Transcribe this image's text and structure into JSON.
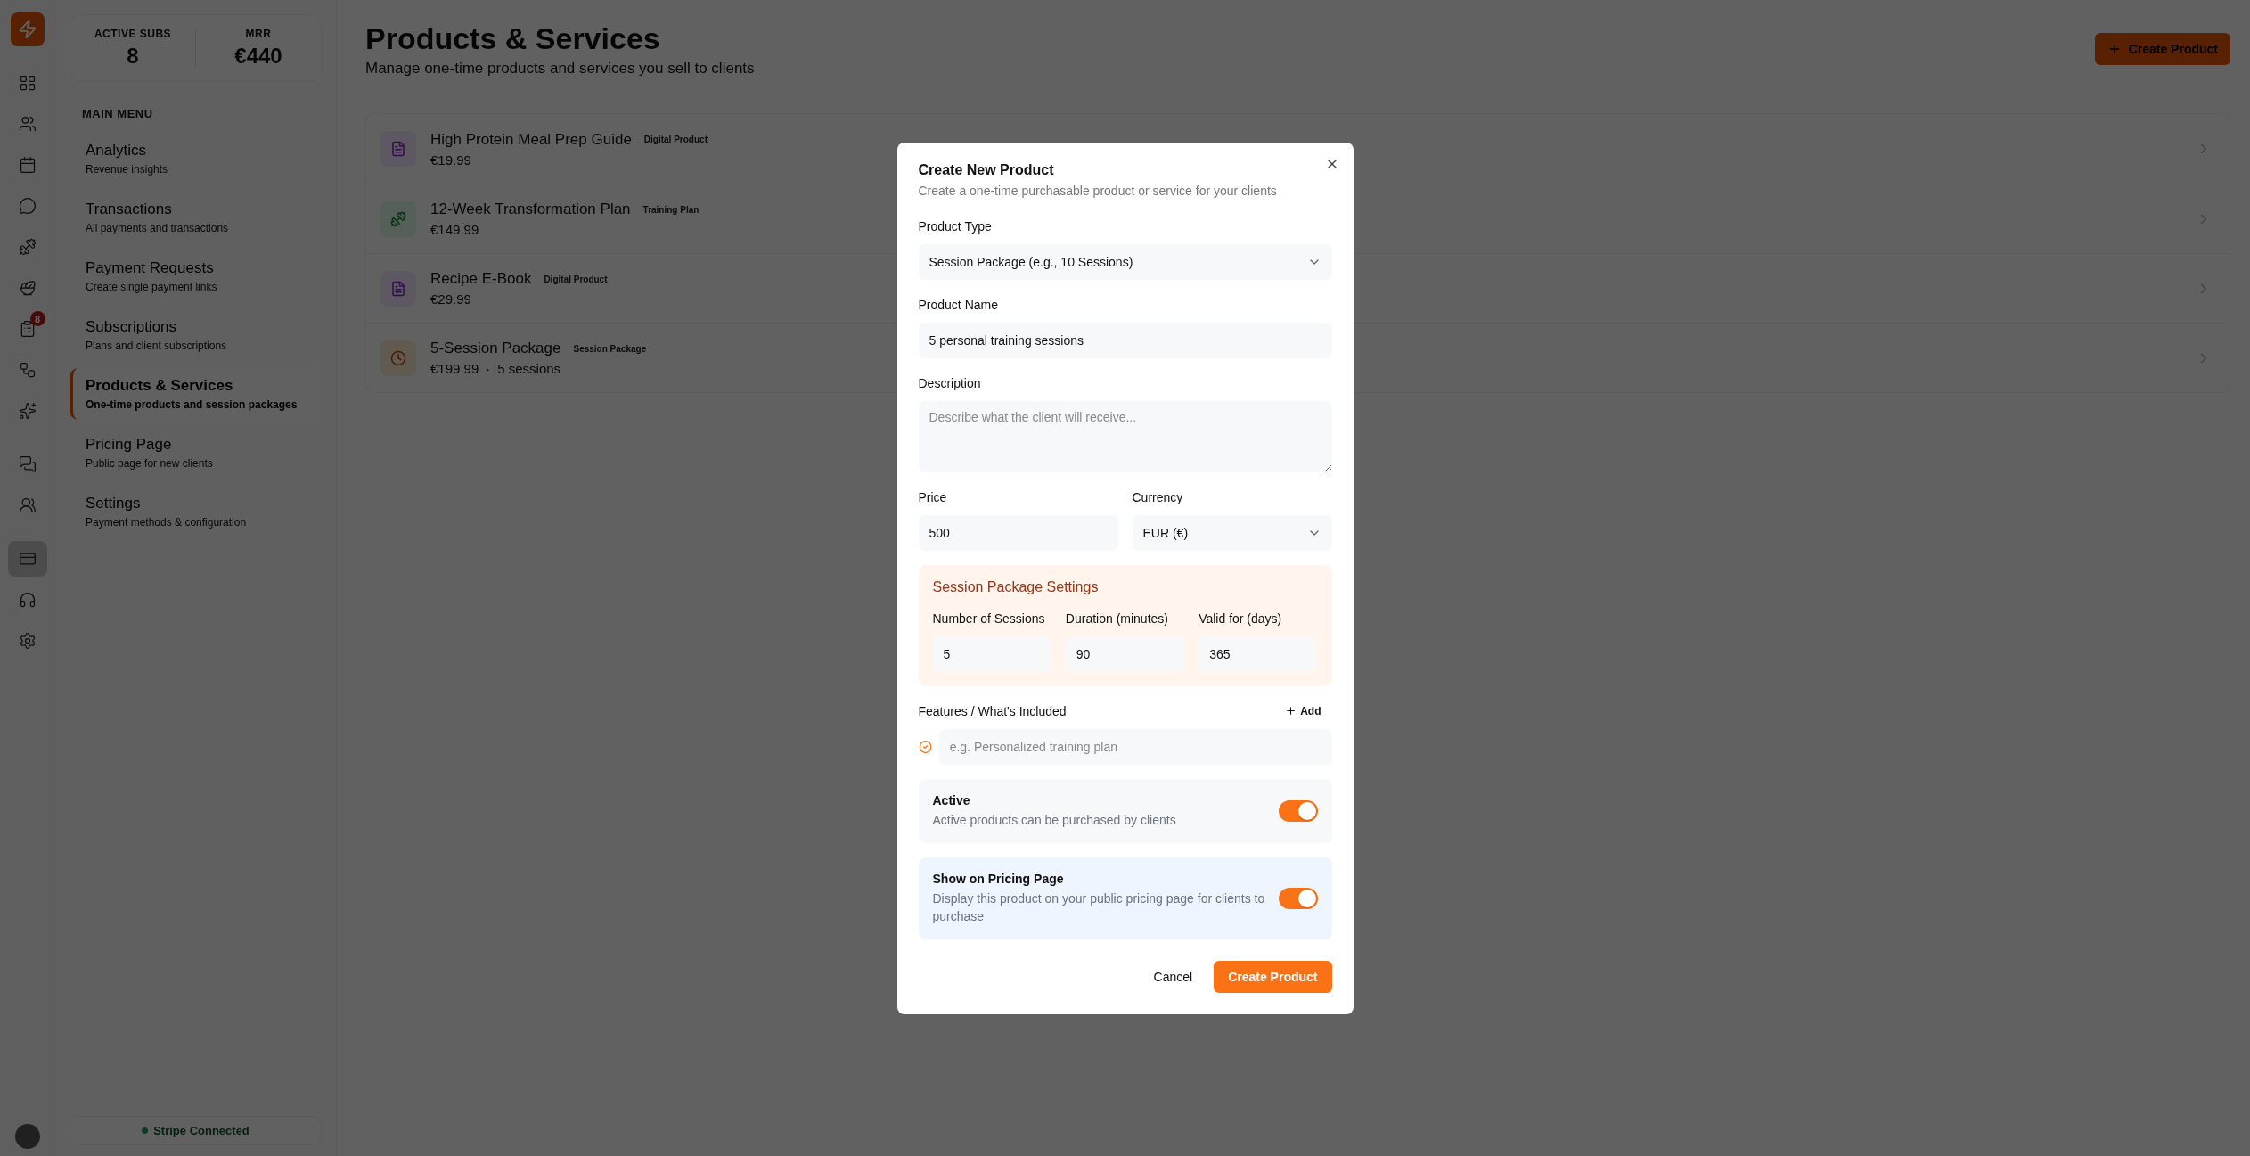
{
  "rail": {
    "items": [
      {
        "selected": false
      },
      {
        "selected": false
      },
      {
        "selected": false
      },
      {
        "selected": false
      },
      {
        "selected": false
      },
      {
        "selected": false
      },
      {
        "selected": false,
        "badge": "8"
      },
      {
        "selected": false
      },
      {
        "selected": false
      },
      {
        "selected": false
      },
      {
        "selected": false
      },
      {
        "selected": true
      },
      {
        "selected": false
      },
      {
        "selected": false
      }
    ]
  },
  "sidebar": {
    "stats": [
      {
        "label": "ACTIVE SUBS",
        "value": "8"
      },
      {
        "label": "MRR",
        "value": "€440"
      }
    ],
    "section_title": "MAIN MENU",
    "items": [
      {
        "title": "Analytics",
        "subtitle": "Revenue insights",
        "selected": false
      },
      {
        "title": "Transactions",
        "subtitle": "All payments and transactions",
        "selected": false
      },
      {
        "title": "Payment Requests",
        "subtitle": "Create single payment links",
        "selected": false
      },
      {
        "title": "Subscriptions",
        "subtitle": "Plans and client subscriptions",
        "selected": false
      },
      {
        "title": "Products & Services",
        "subtitle": "One-time products and session packages",
        "selected": true
      },
      {
        "title": "Pricing Page",
        "subtitle": "Public page for new clients",
        "selected": false
      },
      {
        "title": "Settings",
        "subtitle": "Payment methods & configuration",
        "selected": false
      }
    ],
    "status": "Stripe Connected"
  },
  "page": {
    "title": "Products & Services",
    "subtitle": "Manage one-time products and services you sell to clients",
    "create_button": "Create Product"
  },
  "products": [
    {
      "kind": "digital",
      "name": "High Protein Meal Prep Guide",
      "tag": "Digital Product",
      "price": "€19.99"
    },
    {
      "kind": "training",
      "name": "12-Week Transformation Plan",
      "tag": "Training Plan",
      "price": "€149.99"
    },
    {
      "kind": "digital",
      "name": "Recipe E-Book",
      "tag": "Digital Product",
      "price": "€29.99"
    },
    {
      "kind": "session",
      "name": "5-Session Package",
      "tag": "Session Package",
      "price": "€199.99",
      "separator": "·",
      "extra": "5 sessions"
    }
  ],
  "dialog": {
    "title": "Create New Product",
    "subtitle": "Create a one-time purchasable product or service for your clients",
    "product_type": {
      "label": "Product Type",
      "value": "Session Package (e.g., 10 Sessions)"
    },
    "product_name": {
      "label": "Product Name",
      "value": "5 personal training sessions"
    },
    "description": {
      "label": "Description",
      "placeholder": "Describe what the client will receive..."
    },
    "price": {
      "label": "Price",
      "value": "500"
    },
    "currency": {
      "label": "Currency",
      "value": "EUR (€)"
    },
    "session_settings": {
      "title": "Session Package Settings",
      "fields": [
        {
          "label": "Number of Sessions",
          "value": "5"
        },
        {
          "label": "Duration (minutes)",
          "value": "90"
        },
        {
          "label": "Valid for (days)",
          "value": "365"
        }
      ]
    },
    "features": {
      "label": "Features / What's Included",
      "add_button": "Add",
      "placeholder": "e.g. Personalized training plan"
    },
    "toggles": [
      {
        "kind": "plain",
        "title": "Active",
        "description": "Active products can be purchased by clients",
        "on": true
      },
      {
        "kind": "info",
        "title": "Show on Pricing Page",
        "description": "Display this product on your public pricing page for clients to purchase",
        "on": true
      }
    ],
    "cancel_button": "Cancel",
    "submit_button": "Create Product"
  }
}
